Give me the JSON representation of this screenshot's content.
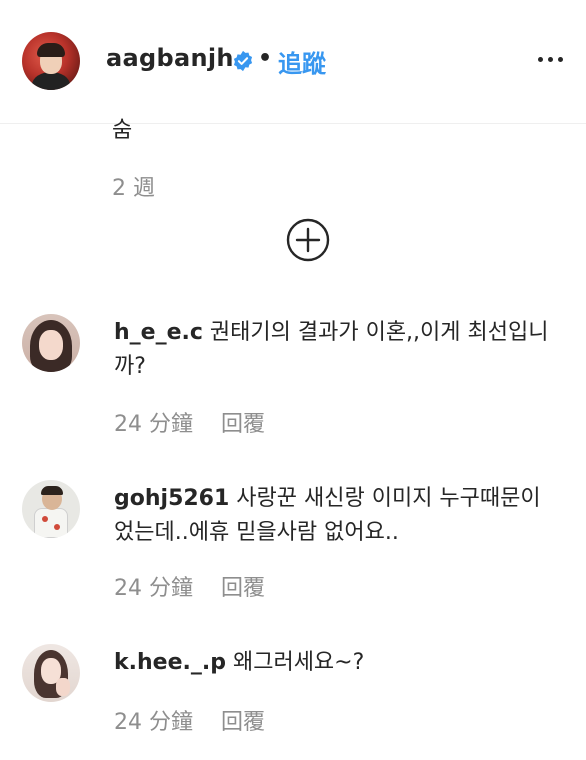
{
  "header": {
    "username": "aagbanjh",
    "separator": "•",
    "follow_label": "追蹤",
    "verified_icon": "verified-badge-icon",
    "more_icon": "more-options-icon"
  },
  "previous_comment": {
    "tail_text": "숨",
    "time": "2 週"
  },
  "load_more_icon": "plus-circle-icon",
  "comments": [
    {
      "username": "h_e_e.c",
      "text": "권태기의 결과가 이혼,,이게 최선입니",
      "text_cont": "까?",
      "time": "24 分鐘",
      "reply_label": "回覆"
    },
    {
      "username": "gohj5261",
      "text": "사랑꾼 새신랑 이미지 누구때문이",
      "text_cont": "었는데..에휴 믿을사람 없어요..",
      "time": "24 分鐘",
      "reply_label": "回覆"
    },
    {
      "username": "k.hee._.p",
      "text": "왜그러세요~?",
      "text_cont": "",
      "time": "24 分鐘",
      "reply_label": "回覆"
    }
  ],
  "colors": {
    "link_blue": "#3897f0",
    "verified_blue": "#3897f0",
    "meta_gray": "#8e8e8e",
    "text": "#262626"
  }
}
